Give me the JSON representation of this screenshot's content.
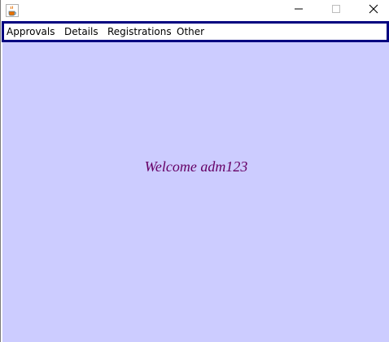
{
  "window": {
    "title": ""
  },
  "menubar": {
    "items": [
      {
        "label": "Approvals"
      },
      {
        "label": "Details"
      },
      {
        "label": "Registrations"
      },
      {
        "label": "Other"
      }
    ]
  },
  "content": {
    "welcome_text": "Welcome adm123",
    "background_color": "#ccccff",
    "text_color": "#660066"
  },
  "menubar_border_color": "#000080",
  "icons": {
    "app": "java-coffee-icon",
    "minimize": "minimize-icon",
    "maximize": "maximize-icon",
    "close": "close-icon"
  }
}
